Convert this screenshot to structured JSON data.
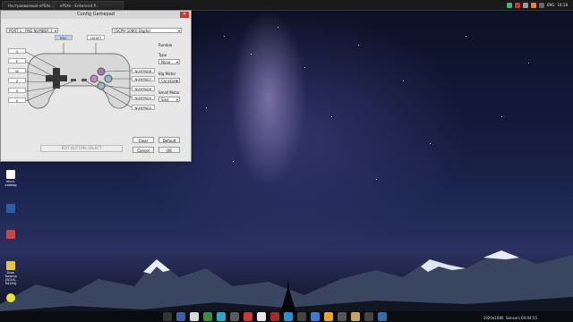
{
  "topbar": {
    "tabs": [
      "Настраиваемый ePSXe...",
      "ePSXe - Enhanced P..."
    ],
    "lang": "ENG",
    "time": "18:18"
  },
  "dialog": {
    "title": "Config Gamepad",
    "port_select": "PORT 1 : PAD NUMBER 1",
    "type_select": "[SCPH-1080] Digital",
    "left_keys": [
      "Q",
      "E",
      "W",
      "Z",
      "S",
      "X"
    ],
    "top_left_key": "ESC",
    "top_right_key": "LSHIFT",
    "right_keys": [
      "NUMPAD8",
      "NUMPAD7",
      "NUMPAD6",
      "NUMPAD5",
      "NUMPAD4"
    ],
    "rumble_label": "Rumble",
    "type_label": "Type",
    "type_value": "None",
    "big_motor_label": "Big Motor",
    "big_motor_value": "Constant",
    "small_motor_label": "Small Motor",
    "small_motor_value": "Sine",
    "clear_label": "Clear",
    "default_label": "Default",
    "cancel_label": "Cancel",
    "ok_label": "OK",
    "edit_label": "EDIT BUTTON: SELECT"
  },
  "desktop": {
    "icon1_label": "emul-catalog",
    "icon2_label": "Gran Turismo [SCUS-94194]"
  },
  "taskbar": {
    "res": "1920x1080",
    "clock": "Sensors 00:04:55"
  },
  "colors": {
    "dialog_bg": "#e7e7e7",
    "close_red": "#c8392b",
    "taskbar": "#0a0a0a"
  }
}
